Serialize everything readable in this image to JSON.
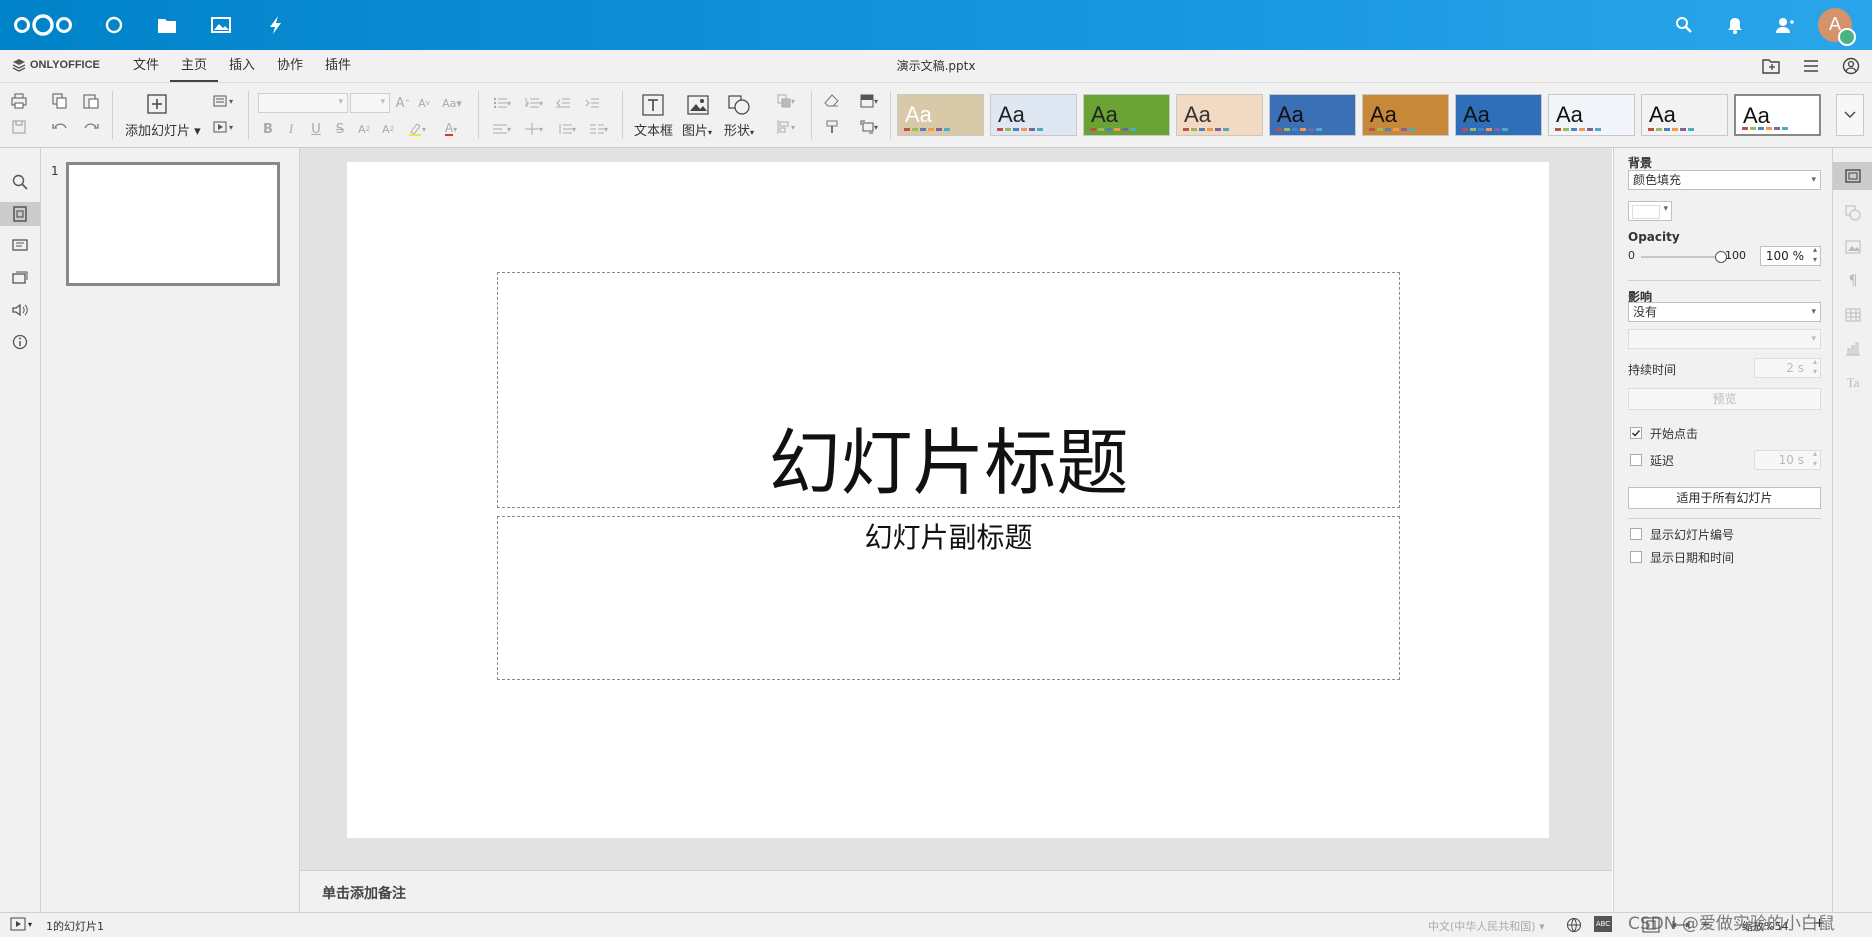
{
  "nextcloud": {
    "icons": [
      "nextcloud-logo",
      "dashboard-icon",
      "files-icon",
      "photos-icon",
      "activity-icon"
    ],
    "right_icons": [
      "search-icon",
      "bell-icon",
      "contacts-icon"
    ],
    "avatar_letter": "A",
    "colors": {
      "bar_start": "#0082c9",
      "bar_end": "#2aa5ea",
      "avatar": "#d4936a",
      "status_dot": "#49b382"
    }
  },
  "onlyoffice": {
    "brand": "ONLYOFFICE",
    "tabs": [
      "文件",
      "主页",
      "插入",
      "协作",
      "插件"
    ],
    "active_tab": "主页",
    "doc_title": "演示文稿.pptx"
  },
  "toolbar": {
    "add_slide": "添加幻灯片",
    "textbox": "文本框",
    "image": "图片",
    "shape": "形状",
    "theme_sample": "Aa",
    "themes": [
      {
        "bg": "#d8c9a8",
        "fg": "#ffffff"
      },
      {
        "bg": "#dfe8f2",
        "fg": "#222222"
      },
      {
        "bg": "#6aa334",
        "fg": "#222222"
      },
      {
        "bg": "#f1d9c2",
        "fg": "#333333"
      },
      {
        "bg": "#3b6fb6",
        "fg": "#111111"
      },
      {
        "bg": "#c8883a",
        "fg": "#111111"
      },
      {
        "bg": "#2f6eb8",
        "fg": "#111111"
      },
      {
        "bg": "#f2f6fb",
        "fg": "#111111"
      },
      {
        "bg": "#f3f3f3",
        "fg": "#111111"
      },
      {
        "bg": "#ffffff",
        "fg": "#111111"
      }
    ]
  },
  "thumbnails": [
    {
      "number": "1"
    }
  ],
  "slide": {
    "title": "幻灯片标题",
    "subtitle": "幻灯片副标题"
  },
  "notes_placeholder": "单击添加备注",
  "right_panel": {
    "background_label": "背景",
    "fill_value": "颜色填充",
    "opacity_label": "Opacity",
    "opacity_min": "0",
    "opacity_max": "100",
    "opacity_value": "100 %",
    "opacity_level": 1.0,
    "effect_label": "影响",
    "effect_value": "没有",
    "duration_label": "持续时间",
    "duration_value": "2 s",
    "preview_button": "预览",
    "start_on_click": "开始点击",
    "start_on_click_checked": true,
    "delay_label": "延迟",
    "delay_checked": false,
    "delay_value": "10 s",
    "apply_all_button": "适用于所有幻灯片",
    "show_slide_number": "显示幻灯片编号",
    "show_date_time": "显示日期和时间"
  },
  "status": {
    "slide_info": "1的幻灯片1",
    "language": "中文(中华人民共和国)",
    "zoom": "缩放%54",
    "watermark": "CSDN @爱做实验的小白鼠"
  }
}
